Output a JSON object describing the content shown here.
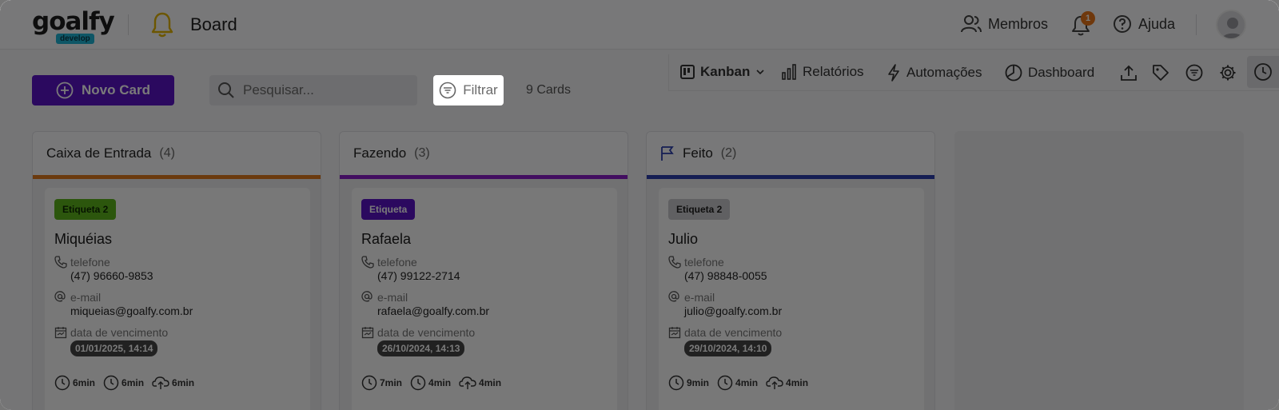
{
  "header": {
    "logo_text": "goalfy",
    "logo_badge": "develop",
    "board_title": "Board",
    "members_label": "Membros",
    "notification_count": "1",
    "help_label": "Ajuda"
  },
  "toolbar": {
    "new_card_label": "Novo Card",
    "search_placeholder": "Pesquisar...",
    "filter_label": "Filtrar",
    "cards_count": "9 Cards"
  },
  "views": {
    "kanban_label": "Kanban",
    "reports_label": "Relatórios",
    "automations_label": "Automações",
    "dashboard_label": "Dashboard"
  },
  "columns": [
    {
      "title": "Caixa de Entrada",
      "count": "(4)",
      "bar_color": "#e07a1f",
      "card": {
        "tag": "Etiqueta 2",
        "tag_bg": "#5db31c",
        "tag_color": "#0d2a00",
        "name": "Miquéias",
        "phone_label": "telefone",
        "phone": "(47) 96660-9853",
        "email_label": "e-mail",
        "email": "miqueias@goalfy.com.br",
        "due_label": "data de vencimento",
        "due": "01/01/2025, 14:14",
        "timer1": "6min",
        "timer2": "6min",
        "timer3": "6min"
      }
    },
    {
      "title": "Fazendo",
      "count": "(3)",
      "bar_color": "#8a1ec9",
      "card": {
        "tag": "Etiqueta",
        "tag_bg": "#5b14c6",
        "tag_color": "#ffffff",
        "name": "Rafaela",
        "phone_label": "telefone",
        "phone": "(47) 99122-2714",
        "email_label": "e-mail",
        "email": "rafaela@goalfy.com.br",
        "due_label": "data de vencimento",
        "due": "26/10/2024, 14:13",
        "timer1": "7min",
        "timer2": "4min",
        "timer3": "4min"
      }
    },
    {
      "title": "Feito",
      "count": "(2)",
      "bar_color": "#2d3fae",
      "card": {
        "tag": "Etiqueta 2",
        "tag_bg": "#c9c9cd",
        "tag_color": "#1e1e1e",
        "name": "Julio",
        "phone_label": "telefone",
        "phone": "(47) 98848-0055",
        "email_label": "e-mail",
        "email": "julio@goalfy.com.br",
        "due_label": "data de vencimento",
        "due": "29/10/2024, 14:10",
        "timer1": "9min",
        "timer2": "4min",
        "timer3": "4min"
      }
    }
  ]
}
